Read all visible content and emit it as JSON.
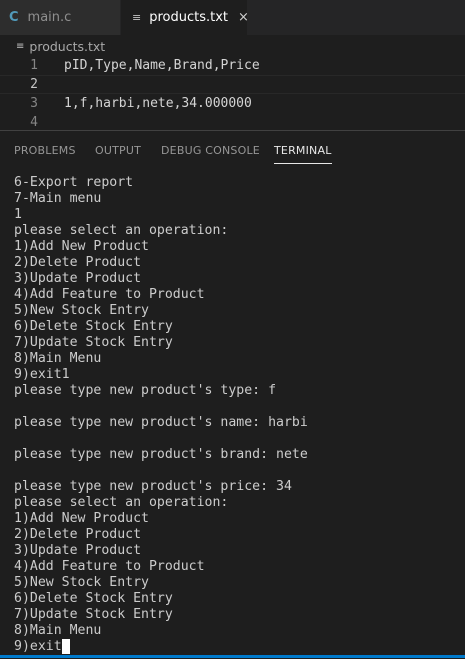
{
  "tabs": [
    {
      "icon": "C",
      "label": "main.c"
    },
    {
      "icon": "≡",
      "label": "products.txt",
      "close": "×"
    }
  ],
  "breadcrumb": {
    "icon": "≡",
    "label": "products.txt"
  },
  "editor": {
    "lines": [
      {
        "num": "1",
        "text": "pID,Type,Name,Brand,Price"
      },
      {
        "num": "2",
        "text": ""
      },
      {
        "num": "3",
        "text": "1,f,harbi,nete,34.000000"
      },
      {
        "num": "4",
        "text": ""
      }
    ]
  },
  "panel": {
    "tabs": [
      "PROBLEMS",
      "OUTPUT",
      "DEBUG CONSOLE",
      "TERMINAL"
    ]
  },
  "terminal": {
    "lines": [
      "6-Export report",
      "7-Main menu",
      "1",
      "please select an operation:",
      "1)Add New Product",
      "2)Delete Product",
      "3)Update Product",
      "4)Add Feature to Product",
      "5)New Stock Entry",
      "6)Delete Stock Entry",
      "7)Update Stock Entry",
      "8)Main Menu",
      "9)exit1",
      "please type new product's type: f",
      "",
      "please type new product's name: harbi",
      "",
      "please type new product's brand: nete",
      "",
      "please type new product's price: 34",
      "please select an operation:",
      "1)Add New Product",
      "2)Delete Product",
      "3)Update Product",
      "4)Add Feature to Product",
      "5)New Stock Entry",
      "6)Delete Stock Entry",
      "7)Update Stock Entry",
      "8)Main Menu"
    ],
    "prompt": "9)exit"
  },
  "colors": {
    "accent": "#007acc",
    "background": "#1e1e1e",
    "c_icon": "#519aba"
  }
}
